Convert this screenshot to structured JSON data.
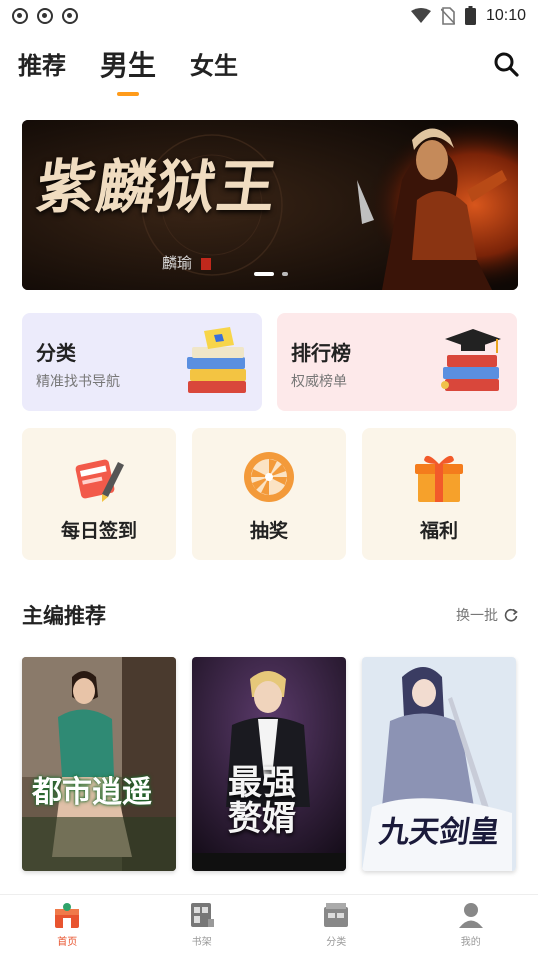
{
  "status_bar": {
    "time": "10:10"
  },
  "tabs": [
    {
      "label": "推荐",
      "active": false
    },
    {
      "label": "男生",
      "active": true
    },
    {
      "label": "女生",
      "active": false
    }
  ],
  "accent_color": "#ff9b1a",
  "banner": {
    "title": "紫麟狱王",
    "author": "麟瑜"
  },
  "categories": [
    {
      "title": "分类",
      "subtitle": "精准找书导航",
      "bg": "#ecebfb",
      "icon": "stacked-books-icon"
    },
    {
      "title": "排行榜",
      "subtitle": "权威榜单",
      "bg": "#fde9ea",
      "icon": "graduation-books-icon"
    }
  ],
  "quick_actions": [
    {
      "label": "每日签到",
      "icon": "checkin-pencil-icon"
    },
    {
      "label": "抽奖",
      "icon": "lottery-wheel-icon"
    },
    {
      "label": "福利",
      "icon": "gift-box-icon"
    }
  ],
  "section": {
    "title": "主编推荐",
    "refresh_label": "换一批"
  },
  "books": [
    {
      "cover_title": "都市逍遥"
    },
    {
      "cover_title": "最强赘婿"
    },
    {
      "cover_title": "九天剑皇"
    }
  ],
  "bottom_nav": [
    {
      "label": "首页",
      "active": true,
      "icon": "home-icon"
    },
    {
      "label": "书架",
      "active": false,
      "icon": "bookshelf-icon"
    },
    {
      "label": "分类",
      "active": false,
      "icon": "category-icon"
    },
    {
      "label": "我的",
      "active": false,
      "icon": "profile-icon"
    }
  ]
}
